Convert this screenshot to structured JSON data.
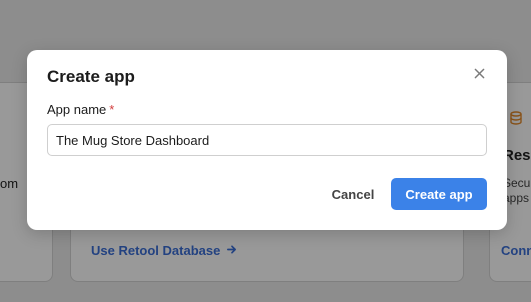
{
  "background": {
    "left_fragment": "om",
    "database_link": "Use Retool Database",
    "right_title": "Reso",
    "right_line1": "Secu",
    "right_line2": "apps",
    "right_link": "Conn"
  },
  "modal": {
    "title": "Create app",
    "field_label": "App name",
    "required_mark": "*",
    "app_name_value": "The Mug Store Dashboard",
    "cancel_label": "Cancel",
    "create_label": "Create app"
  },
  "colors": {
    "primary": "#3b82e8",
    "required": "#d23c3c",
    "link": "#3b6fd8"
  }
}
